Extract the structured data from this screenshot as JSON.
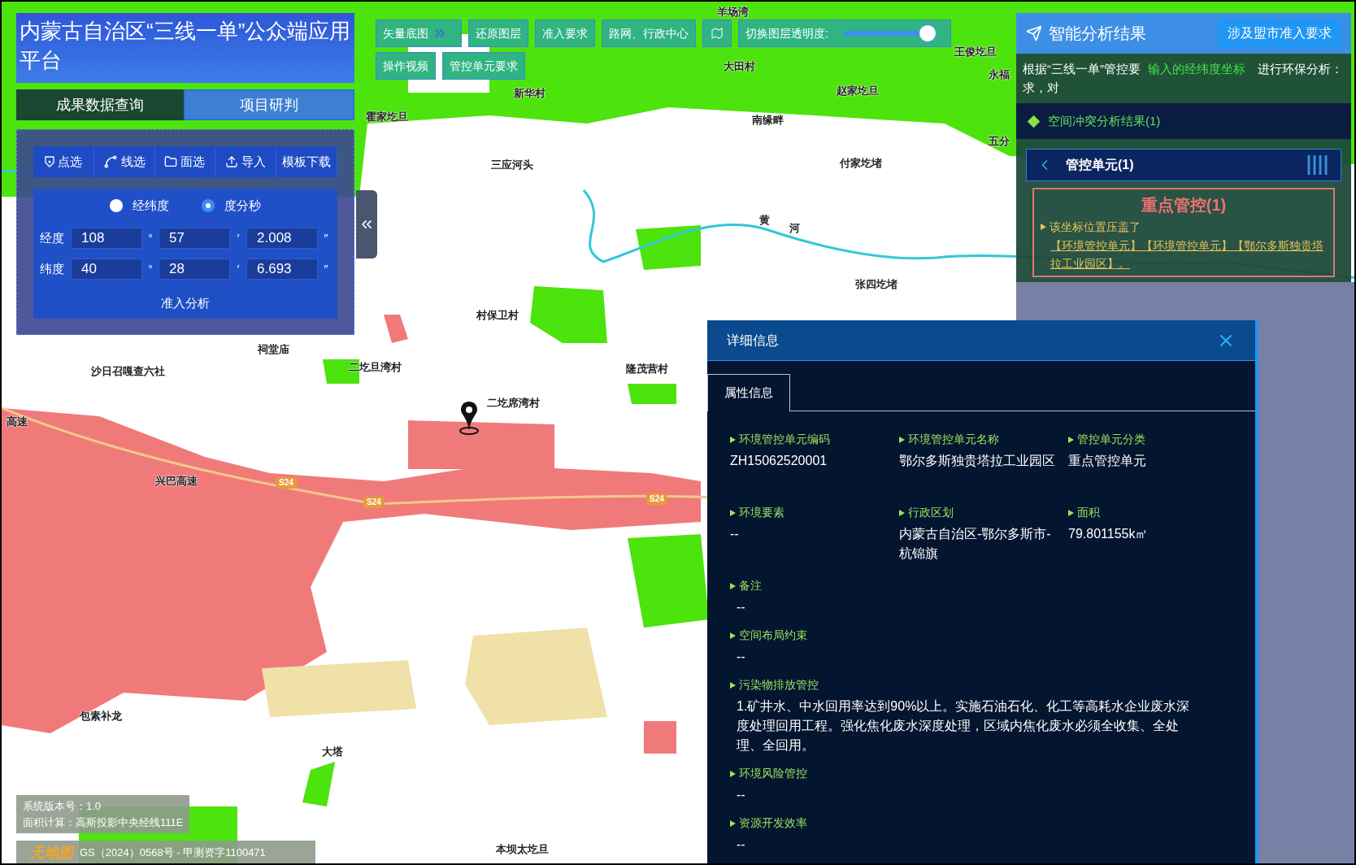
{
  "title": "内蒙古自治区“三线一单”公众端应用平台",
  "main_tabs": [
    {
      "label": "成果数据查询",
      "selected": false
    },
    {
      "label": "项目研判",
      "selected": true
    }
  ],
  "select_tools": [
    {
      "label": "点选",
      "kind": "point"
    },
    {
      "label": "线选",
      "kind": "line"
    },
    {
      "label": "面选",
      "kind": "polygon"
    },
    {
      "label": "导入",
      "kind": "import"
    },
    {
      "label": "模板下载",
      "kind": "text"
    }
  ],
  "coord_modes": [
    {
      "label": "经纬度",
      "selected": false
    },
    {
      "label": "度分秒",
      "selected": true
    }
  ],
  "coords": [
    {
      "label": "经度",
      "fields": [
        {
          "value": "108",
          "unit": "°"
        },
        {
          "value": "57",
          "unit": "′"
        },
        {
          "value": "2.008",
          "unit": "″"
        }
      ]
    },
    {
      "label": "纬度",
      "fields": [
        {
          "value": "40",
          "unit": "°"
        },
        {
          "value": "28",
          "unit": "′"
        },
        {
          "value": "6.693",
          "unit": "″"
        }
      ]
    }
  ],
  "analyze_button": "准入分析",
  "toolbar": {
    "row1": [
      {
        "label": "矢量底图",
        "kind": "basemap"
      },
      {
        "label": "还原图层",
        "kind": "plain"
      },
      {
        "label": "准入要求",
        "kind": "plain"
      },
      {
        "label": "路网、行政中心",
        "kind": "plain"
      },
      {
        "kind": "icon"
      }
    ],
    "row2": [
      {
        "label": "操作视频",
        "kind": "plain"
      },
      {
        "label": "管控单元要求",
        "kind": "plain"
      }
    ],
    "opacity_slider": {
      "label": "切换图层透明度:",
      "level": 0.92
    }
  },
  "map_labels": [
    {
      "text": "羊场湾"
    },
    {
      "text": "王俊圪旦"
    },
    {
      "text": "大田村"
    },
    {
      "text": "新华村"
    },
    {
      "text": "赵家圪旦"
    },
    {
      "text": "霍家圪旦"
    },
    {
      "text": "南缘畔"
    },
    {
      "text": "永福"
    },
    {
      "text": "五分"
    },
    {
      "text": "三应河头"
    },
    {
      "text": "付家圪堵"
    },
    {
      "text": "黄"
    },
    {
      "text": "河"
    },
    {
      "text": "张四圪堵"
    },
    {
      "text": "村保卫村"
    },
    {
      "text": "祠堂庙"
    },
    {
      "text": "沙日召嘎查六社"
    },
    {
      "text": "二圪旦湾村"
    },
    {
      "text": "隆茂营村"
    },
    {
      "text": "二圪席湾村"
    },
    {
      "text": "兴巴高速"
    },
    {
      "text": "包素补龙"
    },
    {
      "text": "大塔"
    },
    {
      "text": "本坝太圪旦"
    },
    {
      "text": "高速"
    }
  ],
  "road_shields": [
    "S24",
    "S24",
    "S24"
  ],
  "results_panel": {
    "title": "智能分析结果",
    "region_button": "涉及盟市准入要求",
    "intro": {
      "prefix": "根据“三线一单”管控要求，对",
      "highlight": "输入的经纬度坐标",
      "suffix": "进行环保分析："
    },
    "section": "空间冲突分析结果(1)",
    "group": {
      "label": "管控单元(1)",
      "expanded": true
    },
    "card": {
      "title": "重点管控(1)",
      "lead": "该坐标位置压盖了",
      "link": "【环境管控单元】【环境管控单元】【鄂尔多斯独贵塔拉工业园区】。"
    }
  },
  "detail_panel": {
    "title": "详细信息",
    "tabs": [
      {
        "label": "属性信息",
        "selected": true
      }
    ],
    "fields": [
      {
        "kind": "grid",
        "label": "环境管控单元编码",
        "value": "ZH15062520001"
      },
      {
        "kind": "grid",
        "label": "环境管控单元名称",
        "value": "鄂尔多斯独贵塔拉工业园区"
      },
      {
        "kind": "grid",
        "label": "管控单元分类",
        "value": "重点管控单元"
      },
      {
        "kind": "grid",
        "label": "环境要素",
        "value": "--"
      },
      {
        "kind": "grid",
        "label": "行政区划",
        "value": "内蒙古自治区-鄂尔多斯市-杭锦旗"
      },
      {
        "kind": "grid",
        "label": "面积",
        "value": "79.801155k㎡"
      },
      {
        "kind": "wide",
        "label": "备注",
        "value": "--"
      },
      {
        "kind": "wide",
        "label": "空间布局约束",
        "value": "--"
      },
      {
        "kind": "wide",
        "label": "污染物排放管控",
        "value": "1.矿井水、中水回用率达到90%以上。实施石油石化、化工等高耗水企业废水深度处理回用工程。强化焦化废水深度处理，区域内焦化废水必须全收集、全处理、全回用。"
      },
      {
        "kind": "wide",
        "label": "环境风险管控",
        "value": "--"
      },
      {
        "kind": "wide",
        "label": "资源开发效率",
        "value": "--"
      }
    ]
  },
  "info_box": {
    "version": "系统版本号：1.0",
    "area_calc": "面积计算：高斯投影中央经线111E"
  },
  "attribution": {
    "logo": "天地图",
    "text": "GS（2024）0568号 - 甲测资字1100471"
  }
}
